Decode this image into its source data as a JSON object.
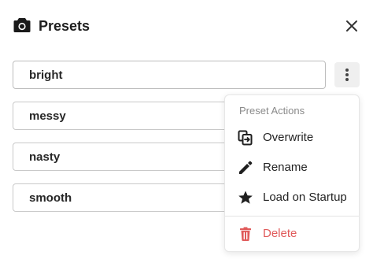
{
  "dialog": {
    "title": "Presets",
    "icons": {
      "header": "camera-icon",
      "close": "close-icon"
    }
  },
  "presets": [
    {
      "name": "bright",
      "active": true
    },
    {
      "name": "messy"
    },
    {
      "name": "nasty"
    },
    {
      "name": "smooth"
    }
  ],
  "menu": {
    "header": "Preset Actions",
    "items": [
      {
        "label": "Overwrite",
        "icon": "overwrite-icon"
      },
      {
        "label": "Rename",
        "icon": "pencil-icon"
      },
      {
        "label": "Load on Startup",
        "icon": "star-icon"
      },
      {
        "label": "Delete",
        "icon": "trash-icon",
        "color": "#e05a5a"
      }
    ]
  },
  "colors": {
    "danger": "#e05a5a",
    "kebab_bg": "#efefef",
    "border": "#c9c9c9"
  }
}
